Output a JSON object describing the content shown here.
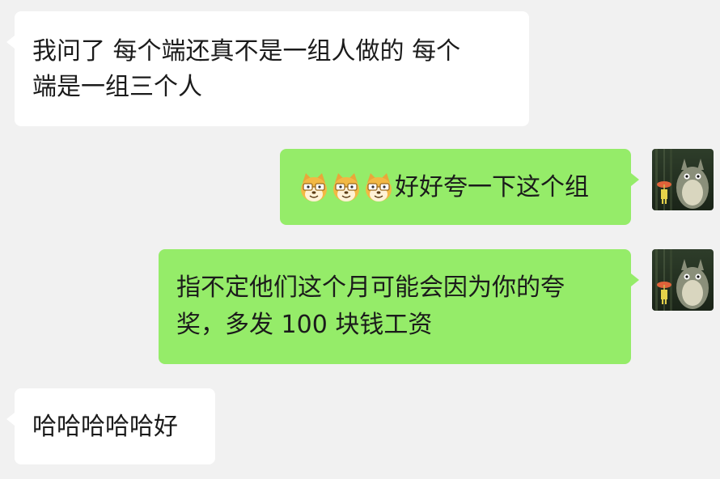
{
  "messages": [
    {
      "side": "left",
      "lines": [
        "我问了 每个端还真不是一组人做的 每个",
        "端是一组三个人"
      ]
    },
    {
      "side": "right",
      "emoji": [
        "cat-doge-emoji",
        "cat-doge-emoji",
        "cat-doge-emoji"
      ],
      "text": "好好夸一下这个组"
    },
    {
      "side": "right",
      "lines": [
        "指不定他们这个月可能会因为你的夸",
        "奖，多发 100 块钱工资"
      ]
    },
    {
      "side": "left",
      "text": "哈哈哈哈哈好"
    }
  ],
  "colors": {
    "background": "#f1f1f1",
    "incoming_bubble": "#ffffff",
    "outgoing_bubble": "#95ec69"
  },
  "avatar": "totoro-avatar"
}
